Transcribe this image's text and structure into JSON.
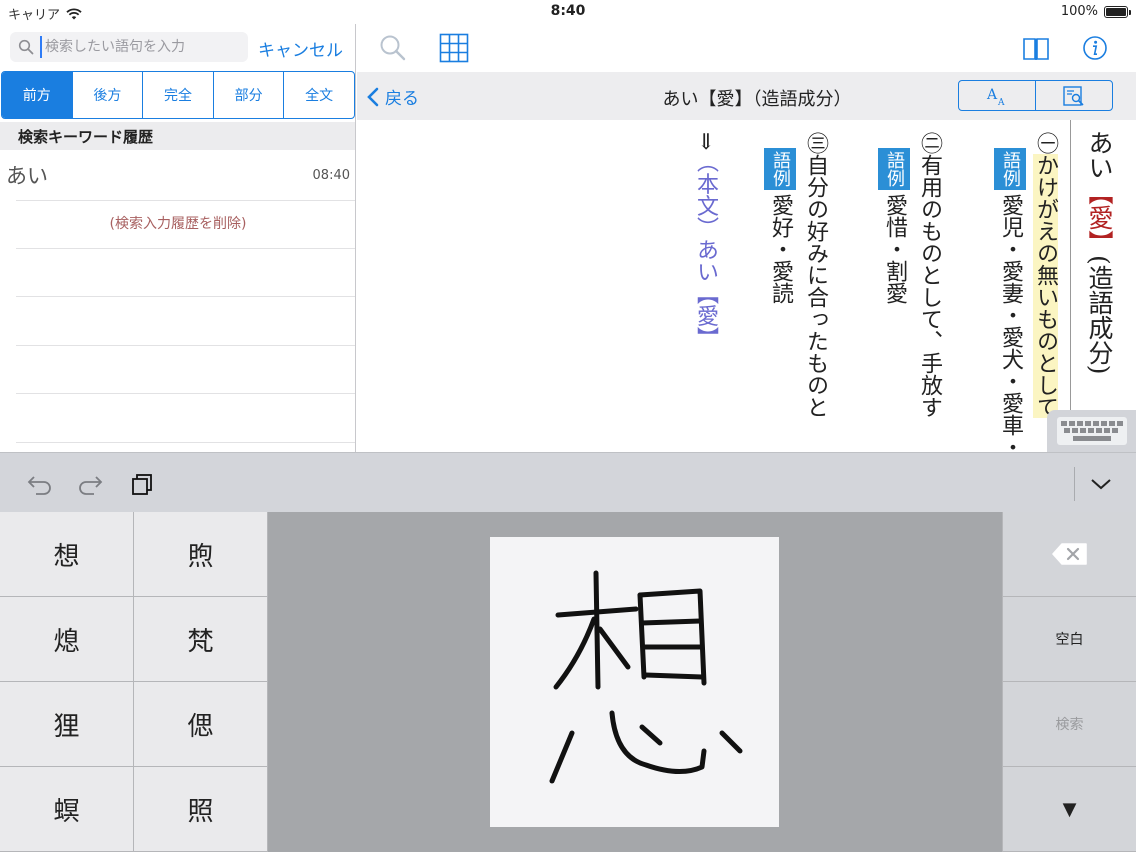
{
  "status": {
    "carrier": "キャリア",
    "time": "8:40",
    "battery": "100%"
  },
  "search": {
    "placeholder": "検索したい語句を入力",
    "value": "",
    "cancel_label": "キャンセル"
  },
  "search_modes": [
    "前方",
    "後方",
    "完全",
    "部分",
    "全文"
  ],
  "history": {
    "header": "検索キーワード履歴",
    "items": [
      {
        "word": "あい",
        "time": "08:40"
      }
    ],
    "delete_label": "(検索入力履歴を削除)"
  },
  "titlebar": {
    "back_label": "戻る",
    "title": "あい【愛】（造語成分）"
  },
  "entry": {
    "head_pre": "あい",
    "head_kanji": "【愛】",
    "head_post": "(造語成分)",
    "sense1": {
      "marker": "㊀",
      "text": "かけがえの無いものとして"
    },
    "example_tag": "語例",
    "ex1": "愛児・愛妻・愛犬・愛車・",
    "sense2": {
      "marker": "㊁",
      "text": "有用のものとして、手放す"
    },
    "ex2": "愛惜・割愛",
    "sense3": {
      "marker": "㊂",
      "text": "自分の好みに合ったものと"
    },
    "ex3": "愛好・愛読",
    "ref_arrow": "⇒",
    "ref_text": "（本文）あい【愛】"
  },
  "candidates": [
    "想",
    "煦",
    "熄",
    "梵",
    "狸",
    "偲",
    "螟",
    "照"
  ],
  "keyboard": {
    "space_label": "空白",
    "search_label": "検索",
    "down_label": "▼"
  },
  "handwriting": {
    "glyph": "想"
  },
  "colors": {
    "accent": "#1a7ee0",
    "highlight": "#fbf5c2",
    "tag": "#2b8fd6",
    "headword_kanji": "#b22222"
  }
}
